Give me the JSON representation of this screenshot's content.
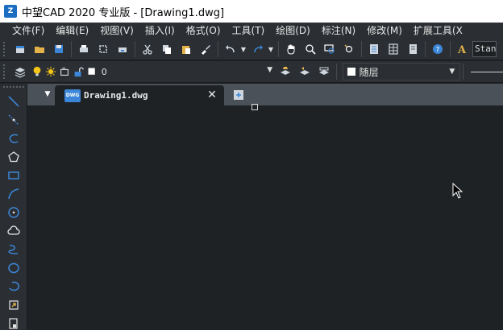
{
  "window": {
    "title": "中望CAD 2020 专业版 - [Drawing1.dwg]",
    "logo_text": "Z"
  },
  "menu": {
    "items": [
      "文件(F)",
      "编辑(E)",
      "视图(V)",
      "插入(I)",
      "格式(O)",
      "工具(T)",
      "绘图(D)",
      "标注(N)",
      "修改(M)",
      "扩展工具(X"
    ]
  },
  "toolbar": {
    "text_style_value": "Stan",
    "layer_value": "0",
    "color_value": "随层"
  },
  "tabs": {
    "document_label": "Drawing1.dwg",
    "dwg_icon_text": "DWG",
    "close_symbol": "✕",
    "menu_arrow": "▼"
  },
  "colors": {
    "accent": "#3b86d8",
    "background": "#1f2225",
    "toolbar": "#2b2f33",
    "tab_strip": "#4a5158"
  }
}
